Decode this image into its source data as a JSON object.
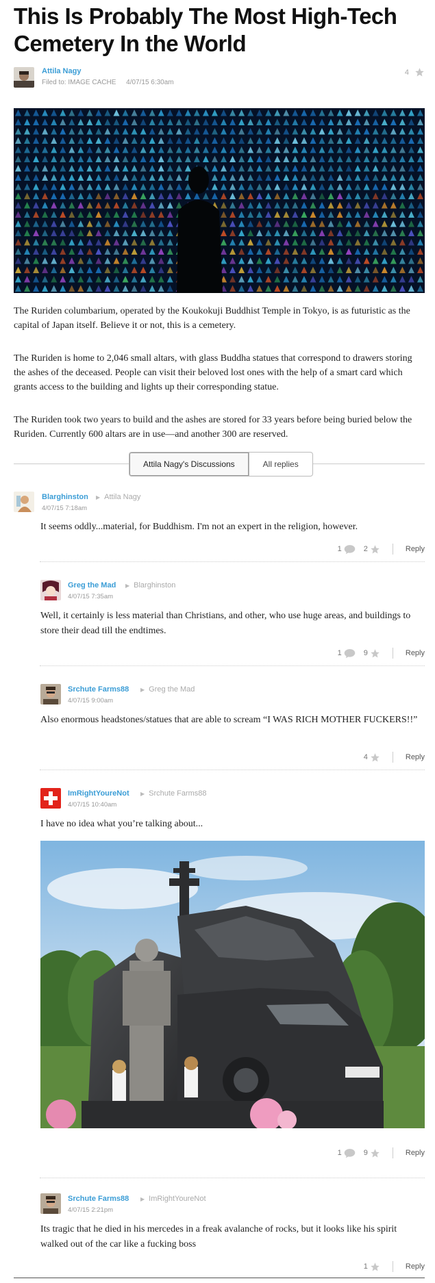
{
  "article": {
    "title": "This Is Probably The Most High-Tech Cemetery In the World",
    "author": "Attila Nagy",
    "filed_to": "Filed to: IMAGE CACHE",
    "date": "4/07/15 6:30am",
    "stars": "4",
    "paragraphs": [
      "The Ruriden columbarium, operated by the Koukokuji Buddhist Temple in Tokyo, is as futuristic as the capital of Japan itself. Believe it or not, this is a cemetery.",
      "The Ruriden is home to 2,046 small altars, with glass Buddha statues that correspond to drawers storing the ashes of the deceased. People can visit their beloved lost ones with the help of a smart card which grants access to the building and lights up their corresponding statue.",
      "The Ruriden took two years to build and the ashes are stored for 33 years before being buried below the Ruriden. Currently 600 altars are in use—and another 300 are reserved."
    ]
  },
  "discussion": {
    "tab_active": "Attila Nagy's Discussions",
    "tab_inactive": "All replies"
  },
  "reply_label": "Reply",
  "comments": [
    {
      "author": "Blarghinston",
      "reply_to": "Attila Nagy",
      "time": "4/07/15 7:18am",
      "text": "It seems oddly...material, for Buddhism. I'm not an expert in the religion, however.",
      "replies": "1",
      "stars": "2"
    },
    {
      "author": "Greg the Mad",
      "reply_to": "Blarghinston",
      "time": "4/07/15 7:35am",
      "text": "Well, it certainly is less material than Christians, and other, who use huge areas, and buildings to store their dead till the endtimes.",
      "replies": "1",
      "stars": "9"
    },
    {
      "author": "Srchute Farms88",
      "reply_to": "Greg the Mad",
      "time": "4/07/15 9:00am",
      "text": "Also enormous headstones/statues that are able to scream “I WAS RICH MOTHER FUCKERS!!”",
      "stars": "4"
    },
    {
      "author": "ImRightYoureNot",
      "reply_to": "Srchute Farms88",
      "time": "4/07/15 10:40am",
      "text": "I have no idea what you’re talking about...",
      "replies": "1",
      "stars": "9"
    },
    {
      "author": "Srchute Farms88",
      "reply_to": "ImRightYoureNot",
      "time": "4/07/15 2:21pm",
      "text": "Its tragic that he died in his mercedes in a freak avalanche of rocks, but it looks like his spirit walked out of the car like a fucking boss",
      "stars": "1"
    }
  ],
  "icons": {
    "star": "star-icon",
    "reply_count": "speech-bubble-icon",
    "reply_to": "caret-right-icon"
  },
  "colors": {
    "link": "#3b9dd6",
    "meta": "#999999"
  }
}
